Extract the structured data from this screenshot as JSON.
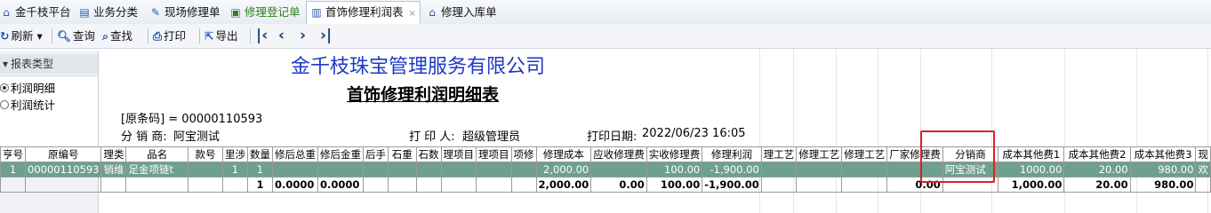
{
  "tabs": [
    {
      "label": "金千枝平台",
      "icon": "home-icon"
    },
    {
      "label": "业务分类",
      "icon": "book-icon"
    },
    {
      "label": "现场修理单",
      "icon": "wrench-icon"
    },
    {
      "label": "修理登记单",
      "icon": "document-icon"
    },
    {
      "label": "首饰修理利润表",
      "icon": "report-icon",
      "close": "×"
    },
    {
      "label": "修理入库单",
      "icon": "warehouse-icon"
    }
  ],
  "toolbar": {
    "refresh": "刷新",
    "query": "查询",
    "find": "查找",
    "print": "打印",
    "export": "导出"
  },
  "sidebar": {
    "header": "报表类型",
    "items": [
      {
        "label": "利润明细",
        "selected": true
      },
      {
        "label": "利润统计",
        "selected": false
      }
    ]
  },
  "report": {
    "company": "金千枝珠宝管理服务有限公司",
    "title": "首饰修理利润明细表",
    "barcode_line": "[原条码] = 00000110593",
    "distributor_label": "分 销 商:",
    "distributor_value": "阿宝测试",
    "printer_label": "打 印 人:",
    "printer_value": "超级管理员",
    "date_label": "打印日期:",
    "date_value": "2022/06/23 16:05"
  },
  "table": {
    "headers": [
      "亨号",
      "原编号",
      "理类",
      "品名",
      "款号",
      "里涉",
      "数量",
      "修后总重",
      "修后金重",
      "后手",
      "石重",
      "石数",
      "理项目",
      "理项目",
      "项修",
      "修理成本",
      "应收修理费",
      "实收修理费",
      "修理利润",
      "理工艺",
      "修理工艺",
      "修理工艺",
      "厂家修理费",
      "分销商",
      "成本其他费1",
      "成本其他费2",
      "成本其他费3",
      "现"
    ],
    "row": [
      "1",
      "00000110593",
      "销维",
      "足金项链t",
      "",
      "1",
      "1",
      "",
      "",
      "",
      "",
      "",
      "",
      "",
      "",
      "2,000.00",
      "",
      "100.00",
      "-1,900.00",
      "",
      "",
      "",
      "",
      "阿宝测试",
      "1000.00",
      "20.00",
      "980.00",
      "欢"
    ],
    "total": [
      "",
      "",
      "",
      "",
      "",
      "",
      "1",
      "0.0000",
      "0.0000",
      "",
      "",
      "",
      "",
      "",
      "",
      "2,000.00",
      "0.00",
      "100.00",
      "-1,900.00",
      "",
      "",
      "",
      "0.00",
      "",
      "1,000.00",
      "20.00",
      "980.00",
      ""
    ]
  }
}
